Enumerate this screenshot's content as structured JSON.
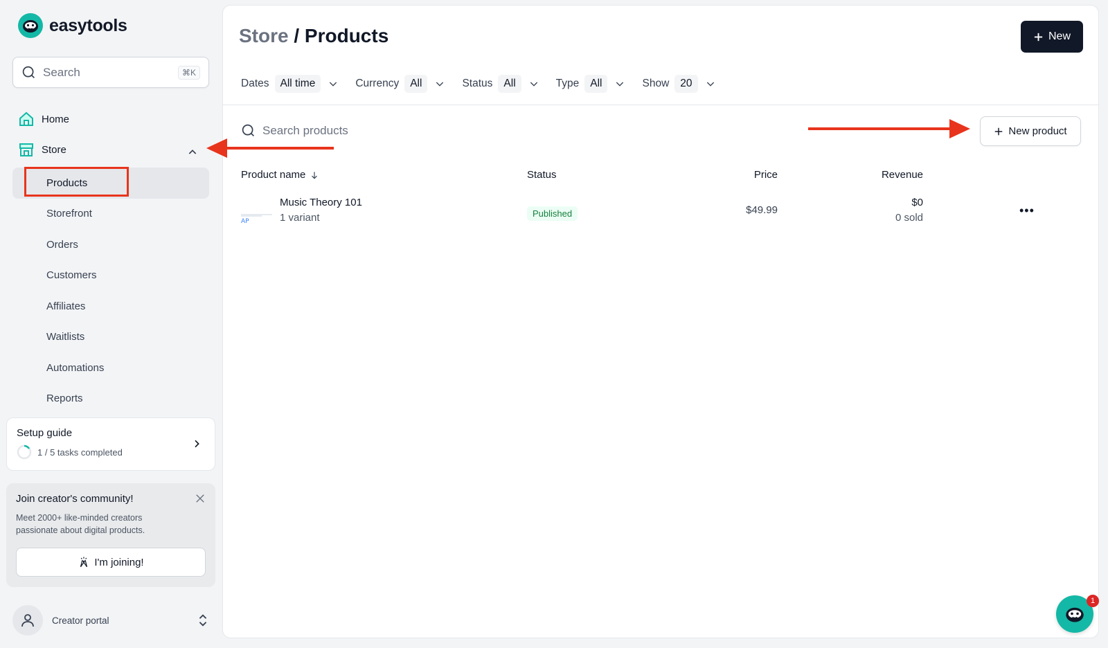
{
  "app": {
    "name": "easytools"
  },
  "sidebar": {
    "search": {
      "placeholder": "Search",
      "shortcut": "⌘K"
    },
    "nav": [
      {
        "label": "Home",
        "icon": "home-icon"
      },
      {
        "label": "Store",
        "icon": "store-icon",
        "expanded": true
      }
    ],
    "store_items": [
      {
        "label": "Products",
        "active": true
      },
      {
        "label": "Storefront"
      },
      {
        "label": "Orders"
      },
      {
        "label": "Customers"
      },
      {
        "label": "Affiliates"
      },
      {
        "label": "Waitlists"
      },
      {
        "label": "Automations"
      },
      {
        "label": "Reports"
      }
    ],
    "setup_guide": {
      "title": "Setup guide",
      "progress": "1 / 5 tasks completed"
    },
    "community": {
      "title": "Join creator's community!",
      "description": "Meet 2000+ like-minded creators passionate about digital products.",
      "button": "I'm joining!"
    },
    "portal": {
      "label": "Creator portal"
    }
  },
  "header": {
    "breadcrumb": "Store",
    "separator": " / ",
    "title": "Products",
    "new_button": "New"
  },
  "filters": [
    {
      "label": "Dates",
      "value": "All time"
    },
    {
      "label": "Currency",
      "value": "All"
    },
    {
      "label": "Status",
      "value": "All"
    },
    {
      "label": "Type",
      "value": "All"
    },
    {
      "label": "Show",
      "value": "20"
    }
  ],
  "products": {
    "search_placeholder": "Search products",
    "new_product_button": "New product",
    "columns": {
      "name": "Product name",
      "status": "Status",
      "price": "Price",
      "revenue": "Revenue"
    },
    "rows": [
      {
        "name": "Music Theory 101",
        "variants": "1 variant",
        "status": "Published",
        "price": "$49.99",
        "revenue": "$0",
        "sold": "0 sold"
      }
    ]
  },
  "chat": {
    "badge": "1"
  },
  "colors": {
    "brand": "#14b8a6",
    "annotation": "#e8341c",
    "primary_button": "#111827",
    "published": "#15803d"
  }
}
